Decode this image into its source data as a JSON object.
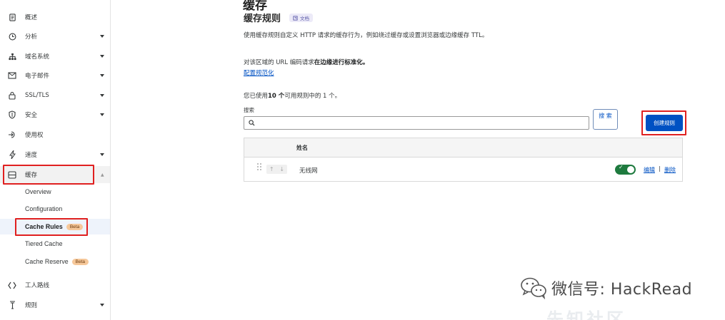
{
  "sidebar": {
    "items": [
      {
        "label": "概述",
        "icon": "document-icon",
        "has_caret": false
      },
      {
        "label": "分析",
        "icon": "clock-icon",
        "has_caret": true
      },
      {
        "label": "域名系统",
        "icon": "network-icon",
        "has_caret": true
      },
      {
        "label": "电子邮件",
        "icon": "email-icon",
        "has_caret": true
      },
      {
        "label": "SSL/TLS",
        "icon": "lock-icon",
        "has_caret": true
      },
      {
        "label": "安全",
        "icon": "shield-icon",
        "has_caret": true
      },
      {
        "label": "使用权",
        "icon": "access-icon",
        "has_caret": false
      },
      {
        "label": "速度",
        "icon": "lightning-icon",
        "has_caret": true
      },
      {
        "label": "缓存",
        "icon": "cache-icon",
        "has_caret": "up"
      },
      {
        "label": "工人路线",
        "icon": "workers-icon",
        "has_caret": false
      },
      {
        "label": "规则",
        "icon": "rules-icon",
        "has_caret": true
      }
    ],
    "cache_subitems": [
      {
        "label": "Overview",
        "badge": ""
      },
      {
        "label": "Configuration",
        "badge": ""
      },
      {
        "label": "Cache Rules",
        "badge": "Beta"
      },
      {
        "label": "Tiered Cache",
        "badge": ""
      },
      {
        "label": "Cache Reserve",
        "badge": "Beta"
      }
    ]
  },
  "main": {
    "page_title": "缓存",
    "section_title": "缓存规则",
    "doc_badge": "文档",
    "description": "使用缓存规则自定义 HTTP 请求的缓存行为，例如绕过缓存或设置浏览器或边缘缓存 TTL。",
    "normalization_prefix": "对该区域的 URL 编码请求",
    "normalization_bold": "在边缘进行标准化。",
    "normalization_link": "配置规范化",
    "usage_prefix": "您已使用",
    "usage_bold": "10 个",
    "usage_suffix": "可用规则中的 1 个。",
    "search_label": "搜索",
    "search_value": "",
    "search_button": "搜 索",
    "create_button": "创建规则",
    "table": {
      "header_name": "姓名",
      "rows": [
        {
          "name": "无线网",
          "enabled": true,
          "edit": "编辑",
          "separator": "|",
          "delete": "删除"
        }
      ]
    }
  },
  "watermark": {
    "text": "微信号: HackRead",
    "faint_text": "先知社区"
  },
  "colors": {
    "accent_blue": "#0051c3",
    "toggle_green": "#1e7a3e",
    "highlight_red": "#e02020",
    "beta_badge": "#f6c89a"
  }
}
